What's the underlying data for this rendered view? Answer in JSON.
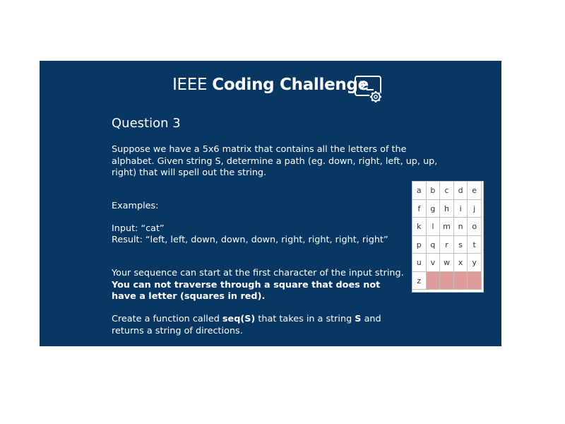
{
  "title": {
    "plain": "IEEE ",
    "bold": "Coding Challenge",
    "icon": "terminal-settings-icon"
  },
  "question_heading": "Question 3",
  "description": "Suppose we have a 5x6 matrix that contains all the letters of the alphabet. Given string S, determine a path (eg. down, right, left, up, up, right) that will spell out the string.",
  "examples": {
    "heading": "Examples:",
    "input": "Input: “cat”",
    "result": "Result: “left, left, down, down, down, right, right, right, right”"
  },
  "rules": {
    "start": "Your sequence can start at the first character of the input string.",
    "constraint": "You can not traverse through a square that does not have a letter (squares in red)."
  },
  "task": {
    "part1": "Create a function called ",
    "func": "seq(S)",
    "part2": " that takes in a string ",
    "param": "S",
    "part3": " and returns a string of directions."
  },
  "matrix": [
    [
      "a",
      "b",
      "c",
      "d",
      "e"
    ],
    [
      "f",
      "g",
      "h",
      "i",
      "j"
    ],
    [
      "k",
      "l",
      "m",
      "n",
      "o"
    ],
    [
      "p",
      "q",
      "r",
      "s",
      "t"
    ],
    [
      "u",
      "v",
      "w",
      "x",
      "y"
    ],
    [
      "z",
      "",
      "",
      "",
      ""
    ]
  ],
  "colors": {
    "background": "#083764",
    "blocked_cell": "#e09b9b"
  }
}
